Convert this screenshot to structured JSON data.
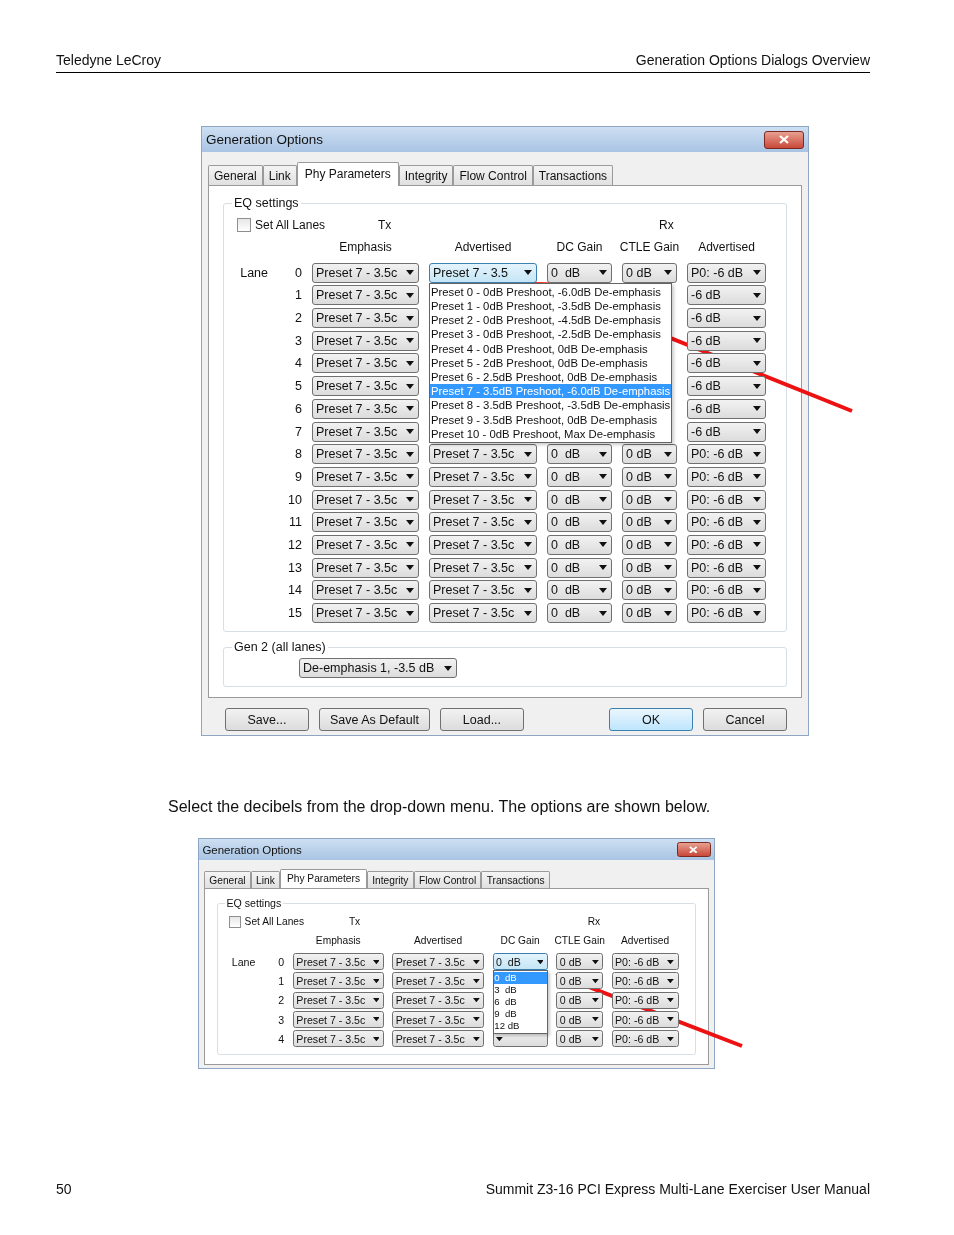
{
  "header": {
    "left": "Teledyne LeCroy",
    "right": "Generation Options Dialogs Overview"
  },
  "content": [
    {
      "kind": "dialog",
      "title": "Generation Options",
      "tabs": [
        {
          "label": "General",
          "selected": false
        },
        {
          "label": "Link",
          "selected": false
        },
        {
          "label": "Phy Parameters",
          "selected": true
        },
        {
          "label": "Integrity",
          "selected": false
        },
        {
          "label": "Flow Control",
          "selected": false
        },
        {
          "label": "Transactions",
          "selected": false
        }
      ],
      "eq_group": {
        "title": "EQ settings",
        "set_all": {
          "label": "Set All Lanes",
          "checked": false
        },
        "tx_label": "Tx",
        "rx_label": "Rx",
        "lane_label": "Lane",
        "columns": [
          "Emphasis",
          "Advertised",
          "DC Gain",
          "CTLE Gain",
          "Advertised"
        ],
        "rows": [
          {
            "lane": "0",
            "cells": [
              {
                "value": "Preset 7 - 3.5c",
                "open": false
              },
              {
                "value": "Preset 7 - 3.5",
                "open": true,
                "options": [
                  {
                    "label": "Preset 0 - 0dB Preshoot, -6.0dB De-emphasis",
                    "selected": false
                  },
                  {
                    "label": "Preset 1 - 0dB Preshoot, -3.5dB De-emphasis",
                    "selected": false
                  },
                  {
                    "label": "Preset 2 - 0dB Preshoot, -4.5dB De-emphasis",
                    "selected": false
                  },
                  {
                    "label": "Preset 3 - 0dB Preshoot, -2.5dB De-emphasis",
                    "selected": false
                  },
                  {
                    "label": "Preset 4 - 0dB Preshoot, 0dB De-emphasis",
                    "selected": false
                  },
                  {
                    "label": "Preset 5 - 2dB Preshoot, 0dB De-emphasis",
                    "selected": false
                  },
                  {
                    "label": "Preset 6 - 2.5dB Preshoot, 0dB De-emphasis",
                    "selected": false
                  },
                  {
                    "label": "Preset 7 - 3.5dB Preshoot, -6.0dB De-emphasis",
                    "selected": true
                  },
                  {
                    "label": "Preset 8 - 3.5dB Preshoot, -3.5dB De-emphasis",
                    "selected": false
                  },
                  {
                    "label": "Preset 9 - 3.5dB Preshoot, 0dB De-emphasis",
                    "selected": false
                  },
                  {
                    "label": "Preset 10 - 0dB Preshoot, Max De-emphasis",
                    "selected": false
                  }
                ]
              },
              {
                "value": "0  dB",
                "open": false
              },
              {
                "value": "0 dB",
                "open": false
              },
              {
                "value": "P0: -6 dB",
                "open": false
              }
            ]
          },
          {
            "lane": "1",
            "cells": [
              {
                "value": "Preset 7 - 3.5c",
                "open": false
              },
              {},
              {},
              {},
              {
                "value": "-6 dB",
                "open": false
              }
            ]
          },
          {
            "lane": "2",
            "cells": [
              {
                "value": "Preset 7 - 3.5c",
                "open": false
              },
              {},
              {},
              {},
              {
                "value": "-6 dB",
                "open": false
              }
            ]
          },
          {
            "lane": "3",
            "cells": [
              {
                "value": "Preset 7 - 3.5c",
                "open": false
              },
              {},
              {},
              {},
              {
                "value": "-6 dB",
                "open": false
              }
            ]
          },
          {
            "lane": "4",
            "cells": [
              {
                "value": "Preset 7 - 3.5c",
                "open": false
              },
              {},
              {},
              {},
              {
                "value": "-6 dB",
                "open": false
              }
            ]
          },
          {
            "lane": "5",
            "cells": [
              {
                "value": "Preset 7 - 3.5c",
                "open": false
              },
              {},
              {},
              {},
              {
                "value": "-6 dB",
                "open": false
              }
            ]
          },
          {
            "lane": "6",
            "cells": [
              {
                "value": "Preset 7 - 3.5c",
                "open": false
              },
              {},
              {},
              {},
              {
                "value": "-6 dB",
                "open": false
              }
            ]
          },
          {
            "lane": "7",
            "cells": [
              {
                "value": "Preset 7 - 3.5c",
                "open": false
              },
              {},
              {},
              {},
              {
                "value": "-6 dB",
                "open": false
              }
            ]
          },
          {
            "lane": "8",
            "cells": [
              {
                "value": "Preset 7 - 3.5c",
                "open": false
              },
              {
                "value": "Preset 7 - 3.5c",
                "open": false
              },
              {
                "value": "0  dB",
                "open": false
              },
              {
                "value": "0 dB",
                "open": false
              },
              {
                "value": "P0: -6 dB",
                "open": false
              }
            ]
          },
          {
            "lane": "9",
            "cells": [
              {
                "value": "Preset 7 - 3.5c",
                "open": false
              },
              {
                "value": "Preset 7 - 3.5c",
                "open": false
              },
              {
                "value": "0  dB",
                "open": false
              },
              {
                "value": "0 dB",
                "open": false
              },
              {
                "value": "P0: -6 dB",
                "open": false
              }
            ]
          },
          {
            "lane": "10",
            "cells": [
              {
                "value": "Preset 7 - 3.5c",
                "open": false
              },
              {
                "value": "Preset 7 - 3.5c",
                "open": false
              },
              {
                "value": "0  dB",
                "open": false
              },
              {
                "value": "0 dB",
                "open": false
              },
              {
                "value": "P0: -6 dB",
                "open": false
              }
            ]
          },
          {
            "lane": "11",
            "cells": [
              {
                "value": "Preset 7 - 3.5c",
                "open": false
              },
              {
                "value": "Preset 7 - 3.5c",
                "open": false
              },
              {
                "value": "0  dB",
                "open": false
              },
              {
                "value": "0 dB",
                "open": false
              },
              {
                "value": "P0: -6 dB",
                "open": false
              }
            ]
          },
          {
            "lane": "12",
            "cells": [
              {
                "value": "Preset 7 - 3.5c",
                "open": false
              },
              {
                "value": "Preset 7 - 3.5c",
                "open": false
              },
              {
                "value": "0  dB",
                "open": false
              },
              {
                "value": "0 dB",
                "open": false
              },
              {
                "value": "P0: -6 dB",
                "open": false
              }
            ]
          },
          {
            "lane": "13",
            "cells": [
              {
                "value": "Preset 7 - 3.5c",
                "open": false
              },
              {
                "value": "Preset 7 - 3.5c",
                "open": false
              },
              {
                "value": "0  dB",
                "open": false
              },
              {
                "value": "0 dB",
                "open": false
              },
              {
                "value": "P0: -6 dB",
                "open": false
              }
            ]
          },
          {
            "lane": "14",
            "cells": [
              {
                "value": "Preset 7 - 3.5c",
                "open": false
              },
              {
                "value": "Preset 7 - 3.5c",
                "open": false
              },
              {
                "value": "0  dB",
                "open": false
              },
              {
                "value": "0 dB",
                "open": false
              },
              {
                "value": "P0: -6 dB",
                "open": false
              }
            ]
          },
          {
            "lane": "15",
            "cells": [
              {
                "value": "Preset 7 - 3.5c",
                "open": false
              },
              {
                "value": "Preset 7 - 3.5c",
                "open": false
              },
              {
                "value": "0  dB",
                "open": false
              },
              {
                "value": "0 dB",
                "open": false
              },
              {
                "value": "P0: -6 dB",
                "open": false
              }
            ]
          }
        ]
      },
      "gen2_group": {
        "title": "Gen 2 (all lanes)",
        "value": "De-emphasis 1, -3.5 dB"
      },
      "buttons": [
        {
          "label": "Save...",
          "default": false
        },
        {
          "label": "Save As Default",
          "default": false
        },
        {
          "label": "Load...",
          "default": false
        },
        {
          "label": "OK",
          "default": true
        },
        {
          "label": "Cancel",
          "default": false
        }
      ]
    },
    {
      "kind": "paragraph",
      "text": "Select the decibels from the drop-down menu. The options are shown below."
    },
    {
      "kind": "dialog",
      "title": "Generation Options",
      "tabs": [
        {
          "label": "General",
          "selected": false
        },
        {
          "label": "Link",
          "selected": false
        },
        {
          "label": "Phy Parameters",
          "selected": true
        },
        {
          "label": "Integrity",
          "selected": false
        },
        {
          "label": "Flow Control",
          "selected": false
        },
        {
          "label": "Transactions",
          "selected": false
        }
      ],
      "eq_group": {
        "title": "EQ settings",
        "set_all": {
          "label": "Set All Lanes",
          "checked": false
        },
        "tx_label": "Tx",
        "rx_label": "Rx",
        "lane_label": "Lane",
        "columns": [
          "Emphasis",
          "Advertised",
          "DC Gain",
          "CTLE Gain",
          "Advertised"
        ],
        "rows": [
          {
            "lane": "0",
            "cells": [
              {
                "value": "Preset 7 - 3.5c",
                "open": false
              },
              {
                "value": "Preset 7 - 3.5c",
                "open": false
              },
              {
                "value": "0  dB",
                "open": true,
                "options": [
                  {
                    "label": "0  dB",
                    "selected": true
                  },
                  {
                    "label": "3  dB",
                    "selected": false
                  },
                  {
                    "label": "6  dB",
                    "selected": false
                  },
                  {
                    "label": "9  dB",
                    "selected": false
                  },
                  {
                    "label": "12 dB",
                    "selected": false
                  }
                ]
              },
              {
                "value": "0 dB",
                "open": false
              },
              {
                "value": "P0: -6 dB",
                "open": false
              }
            ]
          },
          {
            "lane": "1",
            "cells": [
              {
                "value": "Preset 7 - 3.5c",
                "open": false
              },
              {
                "value": "Preset 7 - 3.5c",
                "open": false
              },
              {},
              {
                "value": "0 dB",
                "open": false
              },
              {
                "value": "P0: -6 dB",
                "open": false
              }
            ]
          },
          {
            "lane": "2",
            "cells": [
              {
                "value": "Preset 7 - 3.5c",
                "open": false
              },
              {
                "value": "Preset 7 - 3.5c",
                "open": false
              },
              {},
              {
                "value": "0 dB",
                "open": false
              },
              {
                "value": "P0: -6 dB",
                "open": false
              }
            ]
          },
          {
            "lane": "3",
            "cells": [
              {
                "value": "Preset 7 - 3.5c",
                "open": false
              },
              {
                "value": "Preset 7 - 3.5c",
                "open": false
              },
              {},
              {
                "value": "0 dB",
                "open": false
              },
              {
                "value": "P0: -6 dB",
                "open": false
              }
            ]
          },
          {
            "lane": "4",
            "cells": [
              {
                "value": "Preset 7 - 3.5c",
                "open": false
              },
              {
                "value": "Preset 7 - 3.5c",
                "open": false
              },
              {
                "open": false
              },
              {
                "value": "0 dB",
                "open": false
              },
              {
                "value": "P0: -6 dB",
                "open": false
              }
            ]
          }
        ]
      }
    }
  ],
  "footer": {
    "page_number": "50",
    "title": "Summit Z3-16 PCI Express Multi-Lane Exerciser User Manual"
  }
}
